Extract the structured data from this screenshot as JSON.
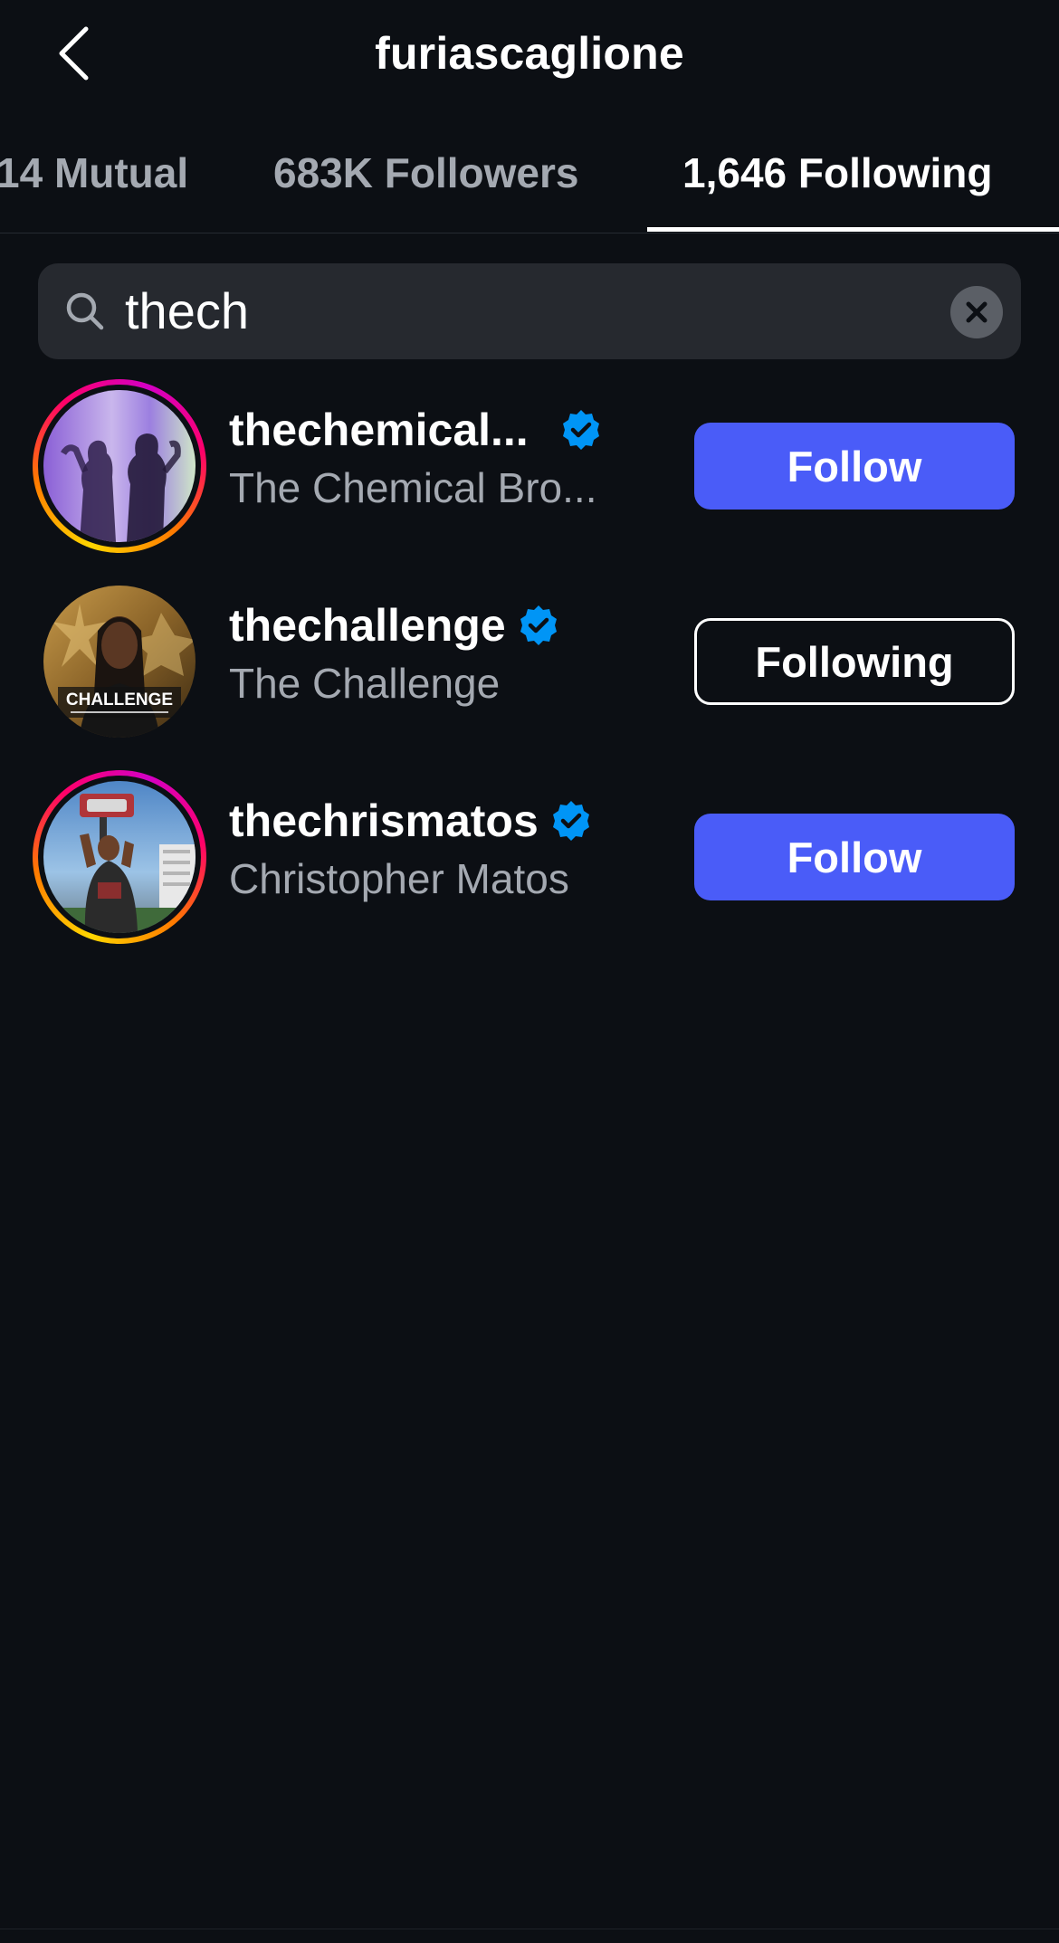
{
  "header": {
    "title": "furiascaglione"
  },
  "tabs": [
    {
      "label": "14 Mutual"
    },
    {
      "label": "683K Followers"
    },
    {
      "label": "1,646 Following",
      "active": true
    }
  ],
  "search": {
    "value": "thech"
  },
  "results": [
    {
      "username": "thechemical...",
      "verified": true,
      "full_name": "The Chemical Bro...",
      "button_label": "Follow",
      "avatar_icon": "avatar-silhouettes",
      "has_story": true
    },
    {
      "username": "thechallenge",
      "verified": true,
      "full_name": "The Challenge",
      "button_label": "Following",
      "avatar_icon": "avatar-challenge-logo",
      "avatar_text": "CHALLENGE",
      "has_story": false
    },
    {
      "username": "thechrismatos",
      "verified": true,
      "full_name": "Christopher Matos",
      "button_label": "Follow",
      "avatar_icon": "avatar-strongman",
      "has_story": true
    }
  ],
  "colors": {
    "background": "#0c0f14",
    "follow_button": "#4a5cf8",
    "verified_badge": "#0095f6",
    "secondary_text": "#a4a9b1"
  }
}
